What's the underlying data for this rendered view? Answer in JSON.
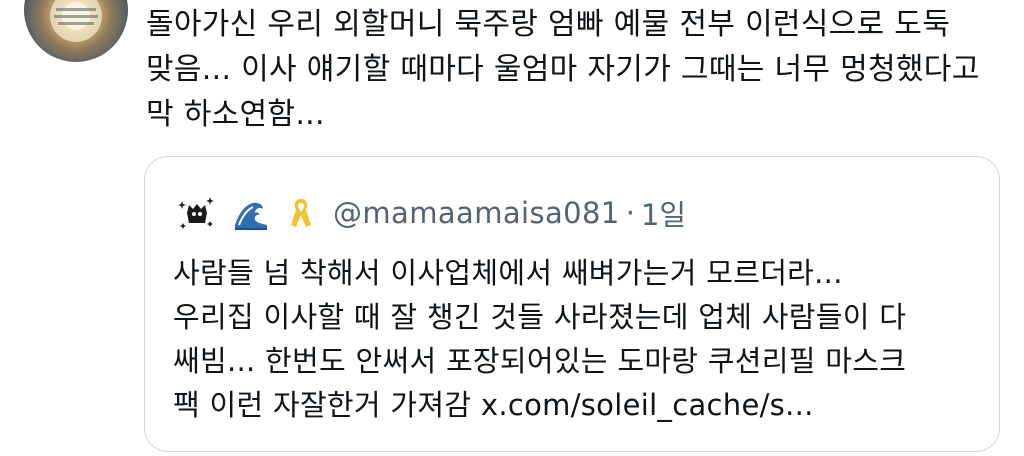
{
  "tweet": {
    "lines": [
      "돌아가신 우리 외할머니 묵주랑 엄빠 예물 전부 이런식으로 도둑",
      "맞음... 이사 얘기할 때마다 울엄마 자기가 그때는 너무 멍청했다고",
      "막 하소연함..."
    ],
    "avatar_icon": "profile-photo"
  },
  "quote": {
    "handle": "@mamaamaisa081",
    "separator": "·",
    "time": "1일",
    "emojis": [
      "sparkle-creature-icon",
      "wave-icon",
      "yellow-ribbon-icon"
    ],
    "lines": [
      "사람들 넘 착해서 이사업체에서 쌔벼가는거 모르더라...",
      "우리집 이사할 때 잘 챙긴 것들 사라졌는데 업체 사람들이 다",
      "쌔빔... 한번도 안써서 포장되어있는 도마랑 쿠션리필 마스크",
      "팩 이런 자잘한거 가져감 x.com/soleil_cache/s..."
    ]
  },
  "colors": {
    "text": "#0f1419",
    "secondary": "#536471",
    "border": "#cfd9de",
    "ribbon": "#f2c230",
    "wave": "#2f6fb3"
  }
}
